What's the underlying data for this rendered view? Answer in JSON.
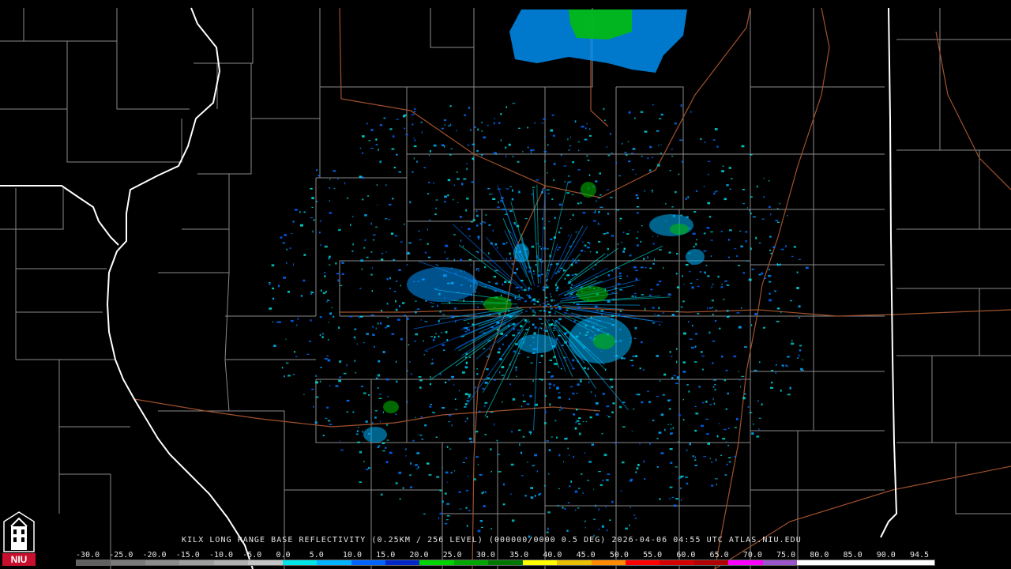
{
  "product": {
    "title": "KILX LONG RANGE BASE REFLECTIVITY (0.25KM / 256 LEVEL) (000000/0000 0.5 DEG) 2026-04-06 04:55 UTC  ATLAS.NIU.EDU"
  },
  "logo": {
    "text": "NIU",
    "color": "#c8102e"
  },
  "radar": {
    "site": "KILX"
  },
  "scale": {
    "labels": [
      "-30.0",
      "-25.0",
      "-20.0",
      "-15.0",
      "-10.0",
      "-5.0",
      "0.0",
      "5.0",
      "10.0",
      "15.0",
      "20.0",
      "25.0",
      "30.0",
      "35.0",
      "40.0",
      "45.0",
      "50.0",
      "55.0",
      "60.0",
      "65.0",
      "70.0",
      "75.0",
      "80.0",
      "85.0",
      "90.0",
      "94.5"
    ],
    "colors": [
      "#606060",
      "#7a7a7a",
      "#8c8c8c",
      "#9e9e9e",
      "#b0b0b0",
      "#c4c4c4",
      "#00e6e6",
      "#00b4ff",
      "#0064ff",
      "#0028c8",
      "#00d400",
      "#00a800",
      "#007800",
      "#ffff00",
      "#e8c000",
      "#ff8c00",
      "#ff0000",
      "#d40000",
      "#b00000",
      "#ff00ff",
      "#9955c9",
      "#ffffff",
      "#ffffff",
      "#ffffff",
      "#ffffff"
    ]
  },
  "map_colors": {
    "state_border": "#ffffff",
    "county_border": "#8a8a8a",
    "highway": "#a0522d",
    "background": "#000000"
  }
}
